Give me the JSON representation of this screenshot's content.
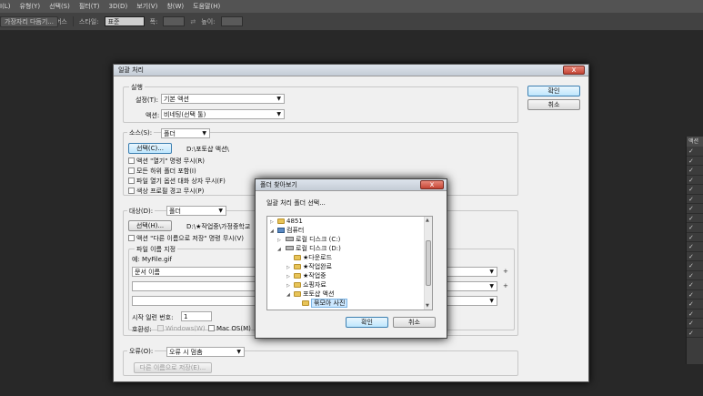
{
  "menubar": [
    "I(L)",
    "유형(Y)",
    "선택(S)",
    "필터(T)",
    "3D(D)",
    "보기(V)",
    "창(W)",
    "도움말(H)"
  ],
  "optbar": {
    "antialias": "앤티 앨리어스",
    "style_label": "스타일:",
    "style_value": "표준",
    "width_label": "폭:",
    "height_label": "높이:",
    "refine_button": "가장자리 다듬기..."
  },
  "panel": {
    "title": "액션",
    "checks": [
      "✓",
      "✓",
      "✓",
      "✓",
      "✓",
      "✓",
      "✓",
      "✓",
      "✓",
      "✓",
      "✓",
      "✓",
      "✓",
      "✓",
      "✓",
      "✓",
      "✓",
      "✓",
      "✓",
      "✓"
    ]
  },
  "batch": {
    "title": "일괄 처리",
    "close": "x",
    "play": {
      "title": "실행",
      "set_label": "설정(T):",
      "set_value": "기본 액션",
      "action_label": "액션:",
      "action_value": "비네팅(선택 툴)"
    },
    "source": {
      "label": "소스(S):",
      "value": "폴더",
      "choose_button": "선택(C)...",
      "path": "D:\\포토샵 액션\\",
      "options": [
        "액션 \"열기\" 명령 무시(R)",
        "모든 하위 폴더 포함(I)",
        "파일 열기 옵션 대화 상자 무시(F)",
        "색상 프로필 경고 무시(P)"
      ]
    },
    "dest": {
      "label": "대상(D):",
      "value": "폴더",
      "choose_button": "선택(H)...",
      "path": "D:\\★작업중\\가정중학교",
      "override": "액션 \"다른 이름으로 저장\" 명령 무시(V)",
      "naming_title": "파일 이름 지정",
      "example": "예: MyFile.gif",
      "field1": "문서 이름",
      "field2": "",
      "field3": "",
      "serial_label": "시작 일련 번호:",
      "serial_value": "1",
      "compat_label": "호환성:",
      "windows": "Windows(W)",
      "macos": "Mac OS(M)"
    },
    "errors": {
      "label": "오류(O):",
      "value": "오류 시 멈춤",
      "save_as": "다른 이름으로 저장(E)..."
    },
    "ok": "확인",
    "cancel": "취소"
  },
  "browse": {
    "title": "폴더 찾아보기",
    "prompt": "일괄 처리 폴더 선택...",
    "tree": [
      {
        "label": "4851"
      },
      {
        "label": "컴퓨터"
      },
      {
        "label": "로컬 디스크 (C:)"
      },
      {
        "label": "로컬 디스크 (D:)"
      },
      {
        "label": "★다운로드"
      },
      {
        "label": "★작업완료"
      },
      {
        "label": "★작업중"
      },
      {
        "label": "쇼핑자료"
      },
      {
        "label": "포토샵 액션"
      },
      {
        "label": "묶모아 사진"
      }
    ],
    "ok": "확인",
    "cancel": "취소"
  }
}
